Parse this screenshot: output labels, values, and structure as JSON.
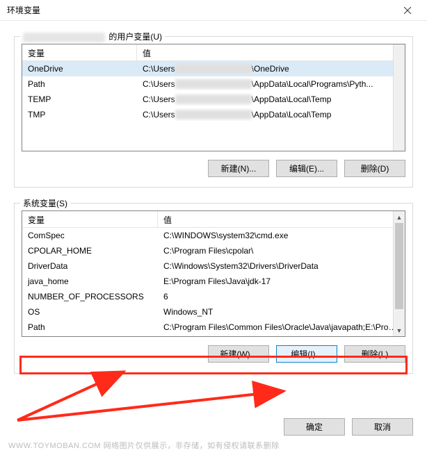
{
  "window": {
    "title": "环境变量"
  },
  "user": {
    "legend_suffix": " 的用户变量(U)",
    "headers": {
      "var": "变量",
      "val": "值"
    },
    "rows": [
      {
        "var": "OneDrive",
        "prefix": "C:\\Users",
        "suffix": "\\OneDrive"
      },
      {
        "var": "Path",
        "prefix": "C:\\Users",
        "suffix": "\\AppData\\Local\\Programs\\Pyth..."
      },
      {
        "var": "TEMP",
        "prefix": "C:\\Users",
        "suffix": "\\AppData\\Local\\Temp"
      },
      {
        "var": "TMP",
        "prefix": "C:\\Users",
        "suffix": "\\AppData\\Local\\Temp"
      }
    ],
    "buttons": {
      "new": "新建(N)...",
      "edit": "编辑(E)...",
      "delete": "删除(D)"
    }
  },
  "system": {
    "legend": "系统变量(S)",
    "headers": {
      "var": "变量",
      "val": "值"
    },
    "rows": [
      {
        "var": "ComSpec",
        "val": "C:\\WINDOWS\\system32\\cmd.exe"
      },
      {
        "var": "CPOLAR_HOME",
        "val": "C:\\Program Files\\cpolar\\"
      },
      {
        "var": "DriverData",
        "val": "C:\\Windows\\System32\\Drivers\\DriverData"
      },
      {
        "var": "java_home",
        "val": "E:\\Program Files\\Java\\jdk-17"
      },
      {
        "var": "NUMBER_OF_PROCESSORS",
        "val": "6"
      },
      {
        "var": "OS",
        "val": "Windows_NT"
      },
      {
        "var": "Path",
        "val": "C:\\Program Files\\Common Files\\Oracle\\Java\\javapath;E:\\Prog..."
      }
    ],
    "buttons": {
      "new": "新建(W)...",
      "edit": "编辑(I)...",
      "delete": "删除(L)"
    }
  },
  "bottom": {
    "ok": "确定",
    "cancel": "取消"
  },
  "watermark": "WWW.TOYMOBAN.COM  网络图片仅供展示，非存储，如有侵权请联系删除"
}
